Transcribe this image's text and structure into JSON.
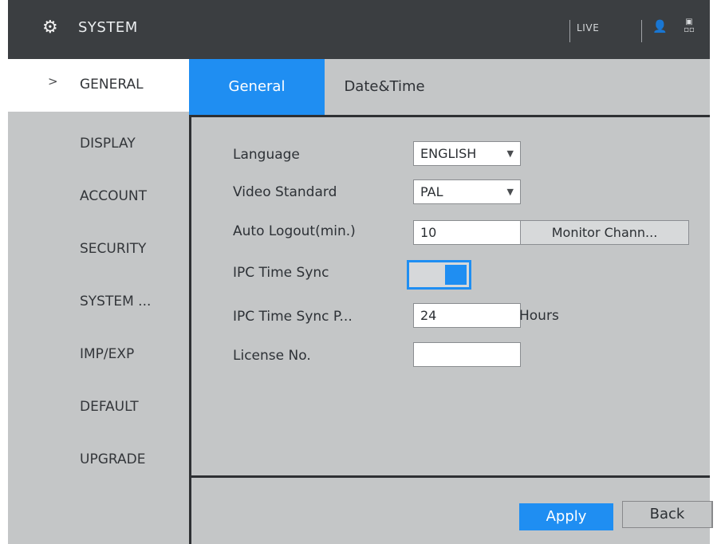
{
  "header": {
    "title": "SYSTEM",
    "live_label": "LIVE",
    "icons": [
      "settings-icon",
      "user-icon",
      "screen-icon"
    ]
  },
  "sidebar": {
    "items": [
      {
        "label": "GENERAL",
        "active": true
      },
      {
        "label": "DISPLAY"
      },
      {
        "label": "ACCOUNT"
      },
      {
        "label": "SECURITY"
      },
      {
        "label": "SYSTEM ..."
      },
      {
        "label": "IMP/EXP"
      },
      {
        "label": "DEFAULT"
      },
      {
        "label": "UPGRADE"
      }
    ]
  },
  "tabs": [
    {
      "label": "General",
      "active": true
    },
    {
      "label": "Date&Time"
    }
  ],
  "form": {
    "language": {
      "label": "Language",
      "value": "ENGLISH"
    },
    "video_standard": {
      "label": "Video Standard",
      "value": "PAL"
    },
    "auto_logout": {
      "label": "Auto Logout(min.)",
      "value": "10",
      "button": "Monitor Chann..."
    },
    "ipc_time_sync": {
      "label": "IPC Time Sync",
      "enabled": true
    },
    "ipc_time_sync_period": {
      "label": "IPC Time Sync P...",
      "value": "24",
      "unit": "Hours"
    },
    "license_no": {
      "label": "License No.",
      "value": ""
    }
  },
  "buttons": {
    "apply": "Apply",
    "back": "Back"
  },
  "colors": {
    "accent": "#1f8ef2",
    "header": "#3b3e41",
    "panel": "#c4c6c7"
  }
}
